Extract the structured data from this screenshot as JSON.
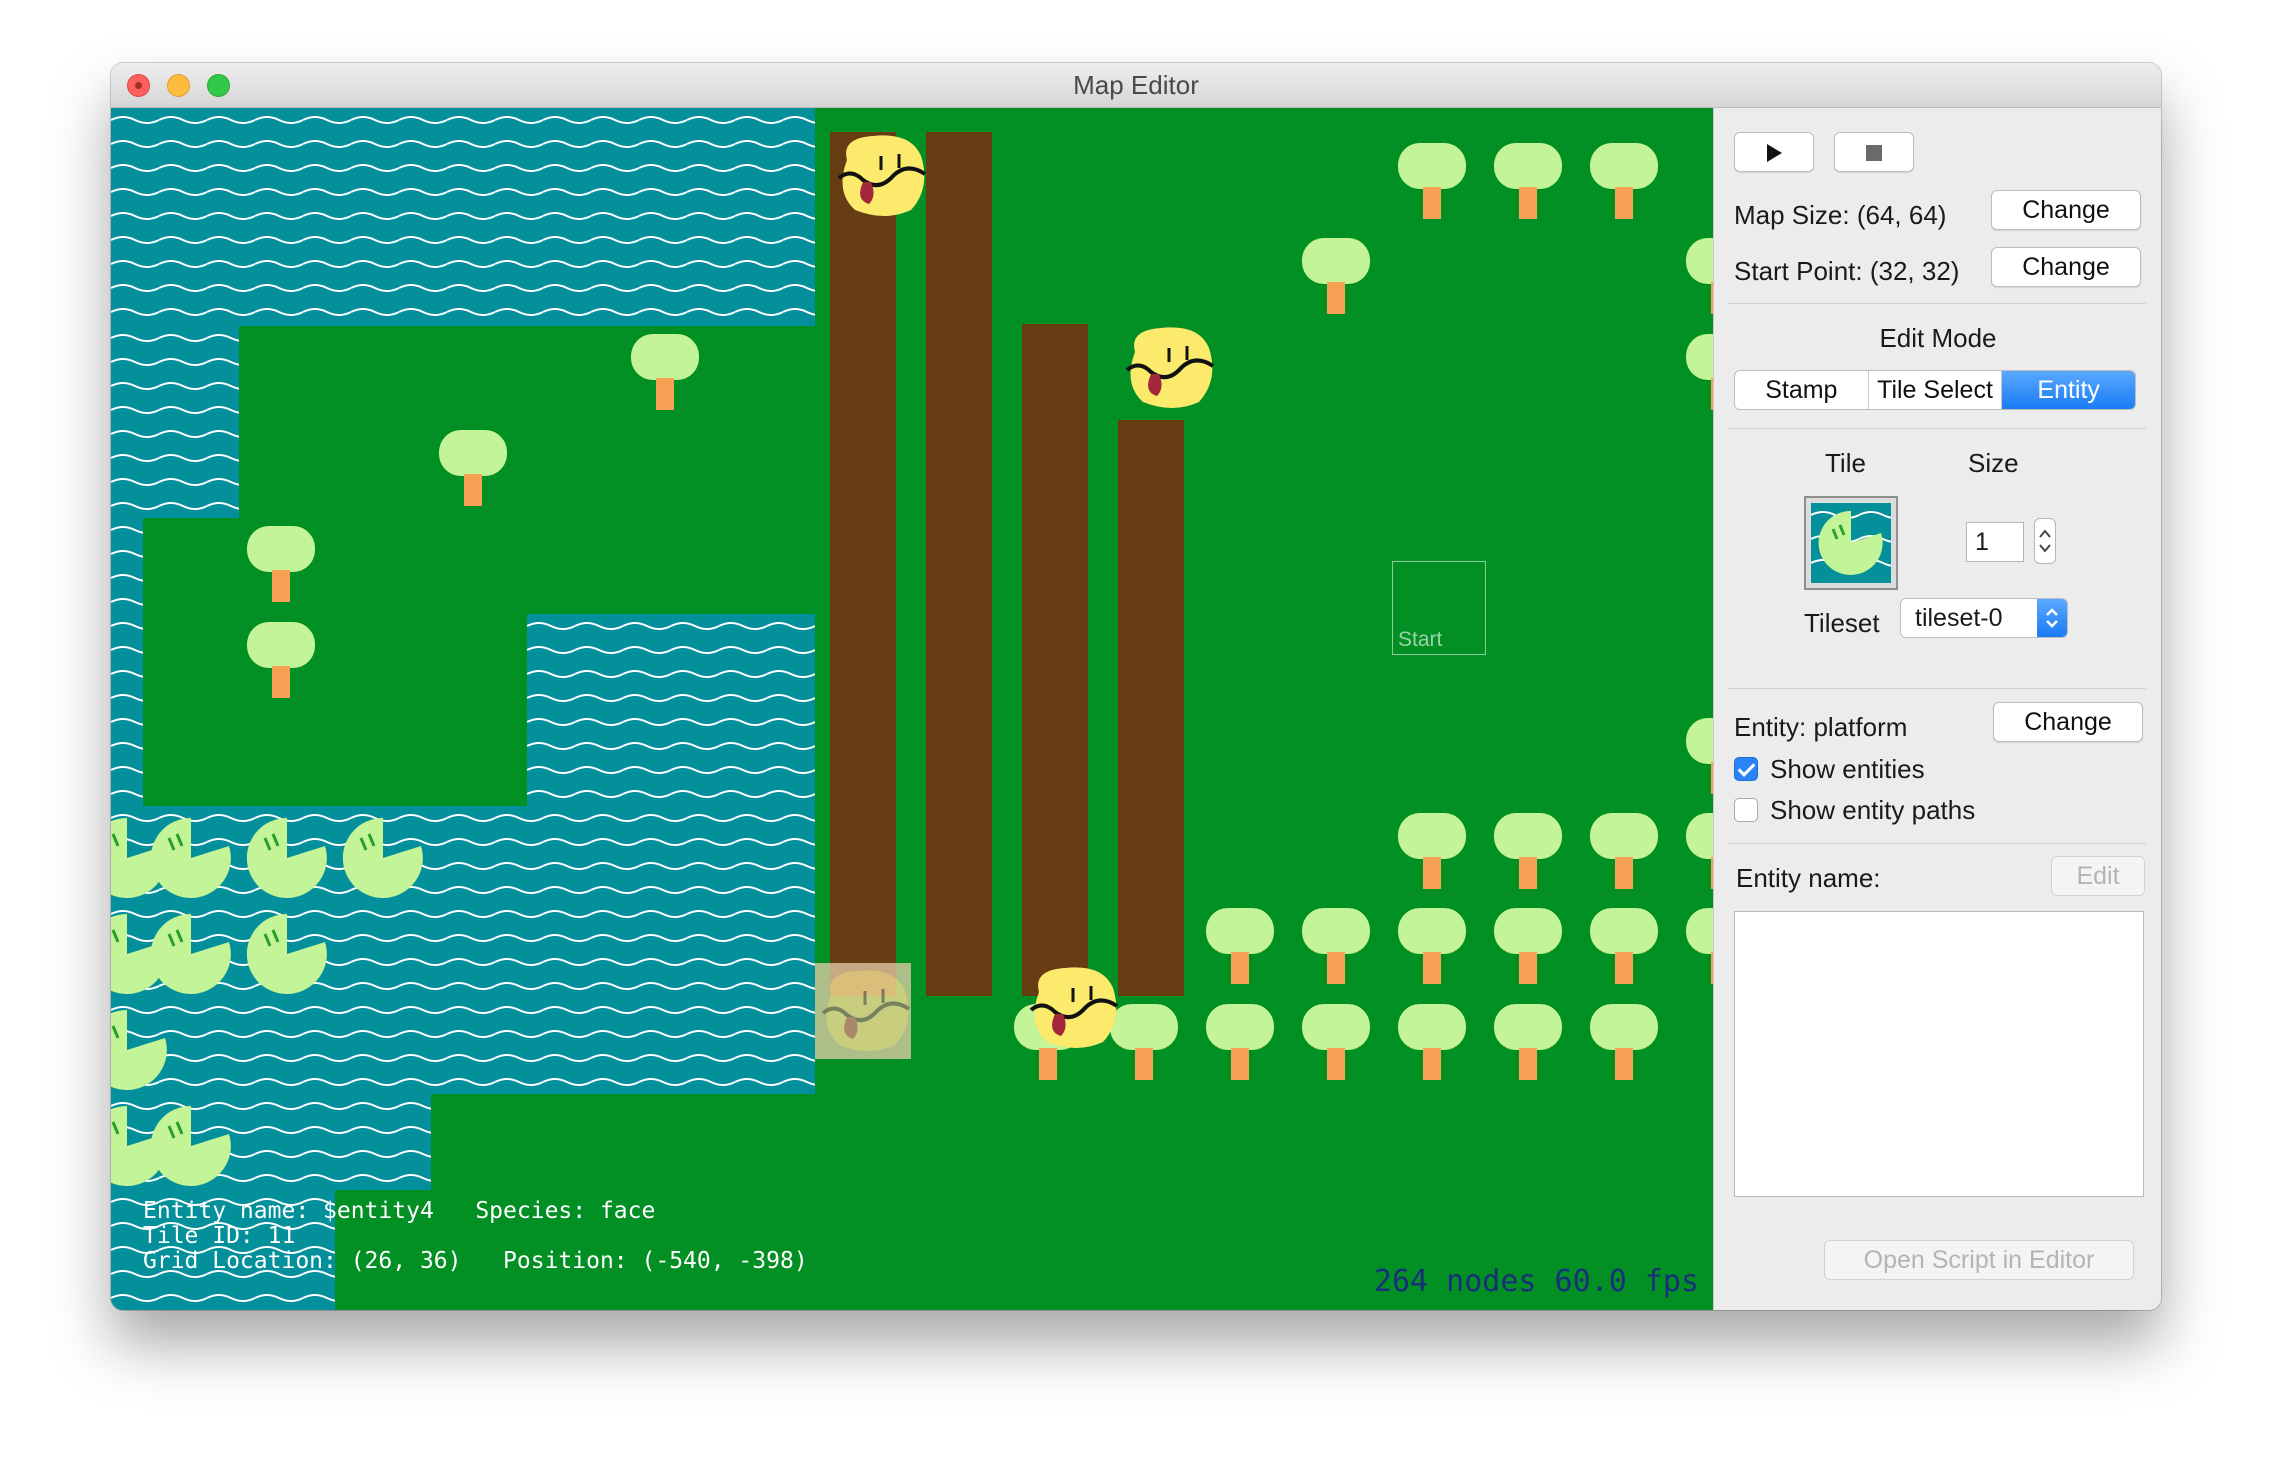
{
  "window": {
    "title": "Map Editor"
  },
  "hud": {
    "line1": "Entity name: $entity4   Species: face",
    "line2": "Tile ID: 11",
    "line3": "Grid Location: (26, 36)   Position: (-540, -398)",
    "stats": "264 nodes 60.0 fps"
  },
  "map": {
    "start_label": "Start"
  },
  "panel": {
    "play_icon": "play-icon",
    "stop_icon": "stop-icon",
    "map_size_label": "Map Size: (64, 64)",
    "start_point_label": "Start Point: (32, 32)",
    "change_label": "Change",
    "edit_mode_label": "Edit Mode",
    "edit_modes": [
      "Stamp",
      "Tile Select",
      "Entity"
    ],
    "edit_mode_selected": "Entity",
    "tile_label": "Tile",
    "size_label": "Size",
    "size_value": "1",
    "tileset_label": "Tileset",
    "tileset_value": "tileset-0",
    "entity_label": "Entity: platform",
    "show_entities": {
      "label": "Show entities",
      "checked": true
    },
    "show_entity_paths": {
      "label": "Show entity paths",
      "checked": false
    },
    "entity_name_label": "Entity name:",
    "edit_label": "Edit",
    "open_script_label": "Open Script in Editor"
  }
}
